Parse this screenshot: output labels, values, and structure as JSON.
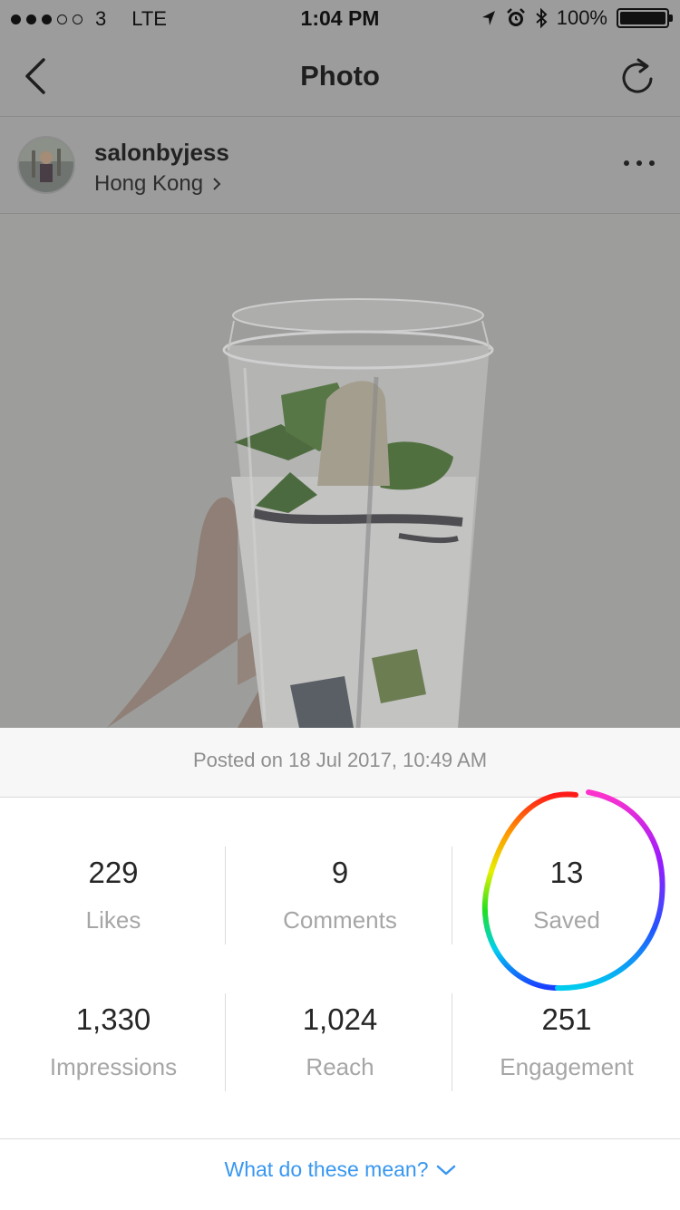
{
  "status_bar": {
    "carrier": "3",
    "network": "LTE",
    "time": "1:04 PM",
    "battery_percent": "100%",
    "battery_level": 1.0
  },
  "nav": {
    "title": "Photo",
    "back_icon": "chevron-left-icon",
    "refresh_icon": "refresh-icon"
  },
  "post": {
    "username": "salonbyjess",
    "location": "Hong Kong",
    "posted_on": "Posted on 18 Jul 2017, 10:49 AM"
  },
  "stats": [
    {
      "value": "229",
      "label": "Likes"
    },
    {
      "value": "9",
      "label": "Comments"
    },
    {
      "value": "13",
      "label": "Saved"
    },
    {
      "value": "1,330",
      "label": "Impressions"
    },
    {
      "value": "1,024",
      "label": "Reach"
    },
    {
      "value": "251",
      "label": "Engagement"
    }
  ],
  "footer": {
    "help_text": "What do these mean?"
  },
  "colors": {
    "link": "#3897f0",
    "dim_overlay": "#9c9c9c",
    "label_gray": "#a6a6a6"
  }
}
